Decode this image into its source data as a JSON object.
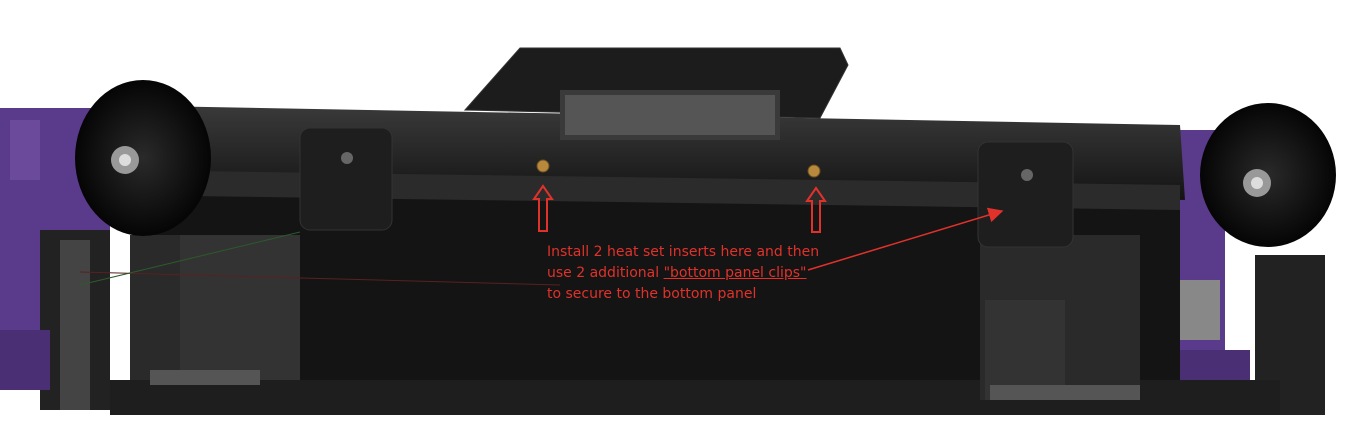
{
  "annotation": {
    "line1": "Install 2 heat set inserts here and then",
    "line2_prefix": "use 2 additional ",
    "line2_link": "\"bottom panel clips\"",
    "line3": "to secure to the bottom panel"
  },
  "colors": {
    "annotation": "#e0322b",
    "frame_purple": "#5a3a8a",
    "body_black": "#1a1a1a",
    "brass_insert": "#b8893c"
  },
  "icons": [
    "up-arrow-icon",
    "up-arrow-icon",
    "pointer-arrow-icon"
  ]
}
